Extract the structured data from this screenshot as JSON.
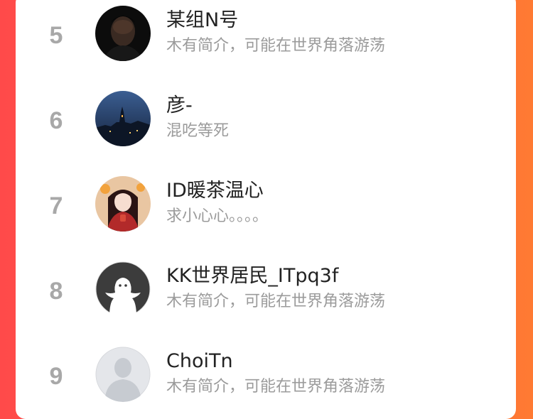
{
  "ranking": {
    "items": [
      {
        "rank": "5",
        "name": "某组N号",
        "bio": "木有简介，可能在世界角落游荡"
      },
      {
        "rank": "6",
        "name": "彦-",
        "bio": "混吃等死"
      },
      {
        "rank": "7",
        "name": "ID暖茶温心",
        "bio": "求小心心。。。。"
      },
      {
        "rank": "8",
        "name": "KK世界居民_ITpq3f",
        "bio": "木有简介，可能在世界角落游荡"
      },
      {
        "rank": "9",
        "name": "ChoiTn",
        "bio": "木有简介，可能在世界角落游荡"
      }
    ]
  },
  "colors": {
    "rank": "#a8a8a8",
    "name": "#222222",
    "bio": "#9b9b9b",
    "background_left": "#ff4a4a",
    "background_right": "#ff7a33"
  }
}
